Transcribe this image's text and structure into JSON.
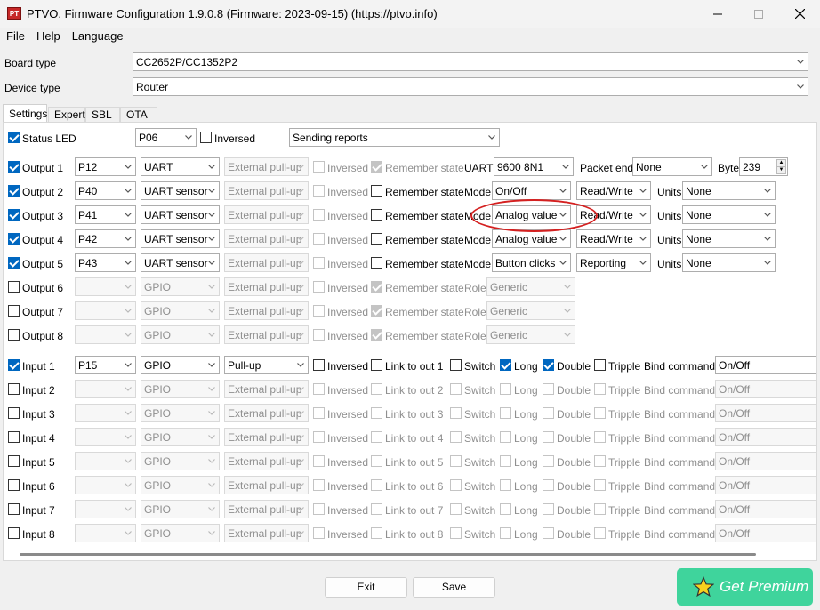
{
  "window": {
    "title": "PTVO. Firmware Configuration 1.9.0.8 (Firmware: 2023-09-15) (https://ptvo.info)",
    "icon_text": "PTVO",
    "minimize_icon": "minimize-icon",
    "maximize_icon": "maximize-icon",
    "close_icon": "close-icon"
  },
  "menu": [
    "File",
    "Help",
    "Language"
  ],
  "board": {
    "label": "Board type",
    "value": "CC2652P/CC1352P2"
  },
  "device": {
    "label": "Device type",
    "value": "Router"
  },
  "tabs": [
    "Settings",
    "Expert",
    "SBL",
    "OTA"
  ],
  "status_led": {
    "label": "Status LED",
    "checked": true,
    "pin": "P06",
    "inversed_label": "Inversed",
    "reports": "Sending reports"
  },
  "outputs": [
    {
      "label": "Output 1",
      "on": true,
      "pin": "P12",
      "fn": "UART",
      "pull": "External pull-up",
      "inv": "Inversed",
      "rem": "Remember state",
      "rem_checked": true,
      "rem_dis": true,
      "c1": "UART",
      "c1v": "9600 8N1",
      "c2": "Packet end",
      "c2v": "None",
      "c3": "Byte",
      "c3v": "239"
    },
    {
      "label": "Output 2",
      "on": true,
      "pin": "P40",
      "fn": "UART sensor",
      "pull": "External pull-up",
      "inv": "Inversed",
      "rem": "Remember state",
      "rem_checked": false,
      "rem_dis": false,
      "c1": "Mode",
      "c1v": "On/Off",
      "c2v": "Read/Write",
      "c3": "Units",
      "c3v": "None"
    },
    {
      "label": "Output 3",
      "on": true,
      "pin": "P41",
      "fn": "UART sensor",
      "pull": "External pull-up",
      "inv": "Inversed",
      "rem": "Remember state",
      "rem_checked": false,
      "rem_dis": false,
      "c1": "Mode",
      "c1v": "Analog value",
      "c2v": "Read/Write",
      "c3": "Units",
      "c3v": "None"
    },
    {
      "label": "Output 4",
      "on": true,
      "pin": "P42",
      "fn": "UART sensor",
      "pull": "External pull-up",
      "inv": "Inversed",
      "rem": "Remember state",
      "rem_checked": false,
      "rem_dis": false,
      "c1": "Mode",
      "c1v": "Analog value",
      "c2v": "Read/Write",
      "c3": "Units",
      "c3v": "None"
    },
    {
      "label": "Output 5",
      "on": true,
      "pin": "P43",
      "fn": "UART sensor",
      "pull": "External pull-up",
      "inv": "Inversed",
      "rem": "Remember state",
      "rem_checked": false,
      "rem_dis": false,
      "c1": "Mode",
      "c1v": "Button clicks",
      "c2v": "Reporting",
      "c3": "Units",
      "c3v": "None"
    },
    {
      "label": "Output 6",
      "on": false,
      "pin": "",
      "fn": "GPIO",
      "pull": "External pull-up",
      "inv": "Inversed",
      "rem": "Remember state",
      "rem_checked": true,
      "rem_dis": true,
      "c1": "Role",
      "c1v": "Generic"
    },
    {
      "label": "Output 7",
      "on": false,
      "pin": "",
      "fn": "GPIO",
      "pull": "External pull-up",
      "inv": "Inversed",
      "rem": "Remember state",
      "rem_checked": true,
      "rem_dis": true,
      "c1": "Role",
      "c1v": "Generic"
    },
    {
      "label": "Output 8",
      "on": false,
      "pin": "",
      "fn": "GPIO",
      "pull": "External pull-up",
      "inv": "Inversed",
      "rem": "Remember state",
      "rem_checked": true,
      "rem_dis": true,
      "c1": "Role",
      "c1v": "Generic"
    }
  ],
  "inputs": [
    {
      "label": "Input 1",
      "on": true,
      "pin": "P15",
      "fn": "GPIO",
      "pull": "Pull-up",
      "inv": "Inversed",
      "link": "Link to out 1",
      "sw": "Switch",
      "long": "Long",
      "long_checked": true,
      "dbl": "Double",
      "dbl_checked": true,
      "tr": "Tripple",
      "bind": "Bind command",
      "bindv": "On/Off"
    },
    {
      "label": "Input 2",
      "on": false,
      "pin": "",
      "fn": "GPIO",
      "pull": "External pull-up",
      "inv": "Inversed",
      "link": "Link to out 2",
      "sw": "Switch",
      "long": "Long",
      "long_checked": false,
      "dbl": "Double",
      "dbl_checked": false,
      "tr": "Tripple",
      "bind": "Bind command",
      "bindv": "On/Off"
    },
    {
      "label": "Input 3",
      "on": false,
      "pin": "",
      "fn": "GPIO",
      "pull": "External pull-up",
      "inv": "Inversed",
      "link": "Link to out 3",
      "sw": "Switch",
      "long": "Long",
      "long_checked": false,
      "dbl": "Double",
      "dbl_checked": false,
      "tr": "Tripple",
      "bind": "Bind command",
      "bindv": "On/Off"
    },
    {
      "label": "Input 4",
      "on": false,
      "pin": "",
      "fn": "GPIO",
      "pull": "External pull-up",
      "inv": "Inversed",
      "link": "Link to out 4",
      "sw": "Switch",
      "long": "Long",
      "long_checked": false,
      "dbl": "Double",
      "dbl_checked": false,
      "tr": "Tripple",
      "bind": "Bind command",
      "bindv": "On/Off"
    },
    {
      "label": "Input 5",
      "on": false,
      "pin": "",
      "fn": "GPIO",
      "pull": "External pull-up",
      "inv": "Inversed",
      "link": "Link to out 5",
      "sw": "Switch",
      "long": "Long",
      "long_checked": false,
      "dbl": "Double",
      "dbl_checked": false,
      "tr": "Tripple",
      "bind": "Bind command",
      "bindv": "On/Off"
    },
    {
      "label": "Input 6",
      "on": false,
      "pin": "",
      "fn": "GPIO",
      "pull": "External pull-up",
      "inv": "Inversed",
      "link": "Link to out 6",
      "sw": "Switch",
      "long": "Long",
      "long_checked": false,
      "dbl": "Double",
      "dbl_checked": false,
      "tr": "Tripple",
      "bind": "Bind command",
      "bindv": "On/Off"
    },
    {
      "label": "Input 7",
      "on": false,
      "pin": "",
      "fn": "GPIO",
      "pull": "External pull-up",
      "inv": "Inversed",
      "link": "Link to out 7",
      "sw": "Switch",
      "long": "Long",
      "long_checked": false,
      "dbl": "Double",
      "dbl_checked": false,
      "tr": "Tripple",
      "bind": "Bind command",
      "bindv": "On/Off"
    },
    {
      "label": "Input 8",
      "on": false,
      "pin": "",
      "fn": "GPIO",
      "pull": "External pull-up",
      "inv": "Inversed",
      "link": "Link to out 8",
      "sw": "Switch",
      "long": "Long",
      "long_checked": false,
      "dbl": "Double",
      "dbl_checked": false,
      "tr": "Tripple",
      "bind": "Bind command",
      "bindv": "On/Off"
    }
  ],
  "buttons": {
    "exit": "Exit",
    "save": "Save",
    "premium": "Get Premium"
  },
  "colors": {
    "accent": "#0067c0",
    "premium": "#3fd49c",
    "annotation": "#d42020"
  }
}
